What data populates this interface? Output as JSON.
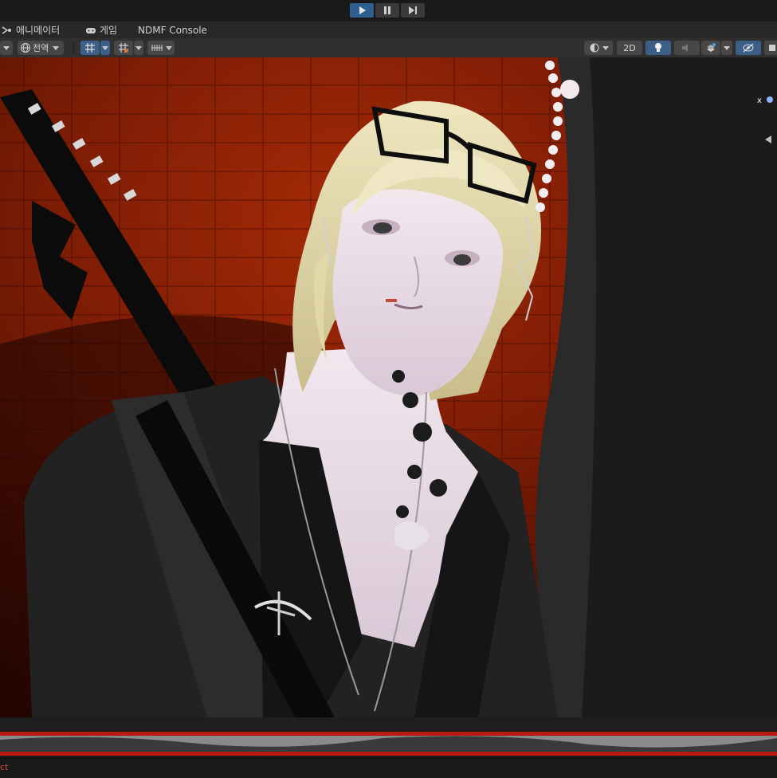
{
  "playbar": {
    "play_icon": "play-icon",
    "pause_icon": "pause-icon",
    "step_icon": "step-icon",
    "accent": "#2f5f8f"
  },
  "tabs": [
    {
      "label": "애니메이터",
      "icon": "animator-icon"
    },
    {
      "label": "게임",
      "icon": "gamepad-icon"
    },
    {
      "label": "NDMF Console",
      "icon": ""
    }
  ],
  "toolbar": {
    "global_label": "전역",
    "twod_label": "2D",
    "icons": [
      "hand-dropdown",
      "globe-icon",
      "grid-snap-icon",
      "grid-icon",
      "snap-increment-icon",
      "shading-mode-icon",
      "lighting-icon",
      "audio-icon",
      "effects-icon",
      "hidden-objects-icon",
      "gizmos-icon"
    ]
  },
  "viewport": {
    "background_color": "#5c1404",
    "description_icons": [
      "scene-gizmo-icon"
    ]
  },
  "status": {
    "text": "ct"
  }
}
